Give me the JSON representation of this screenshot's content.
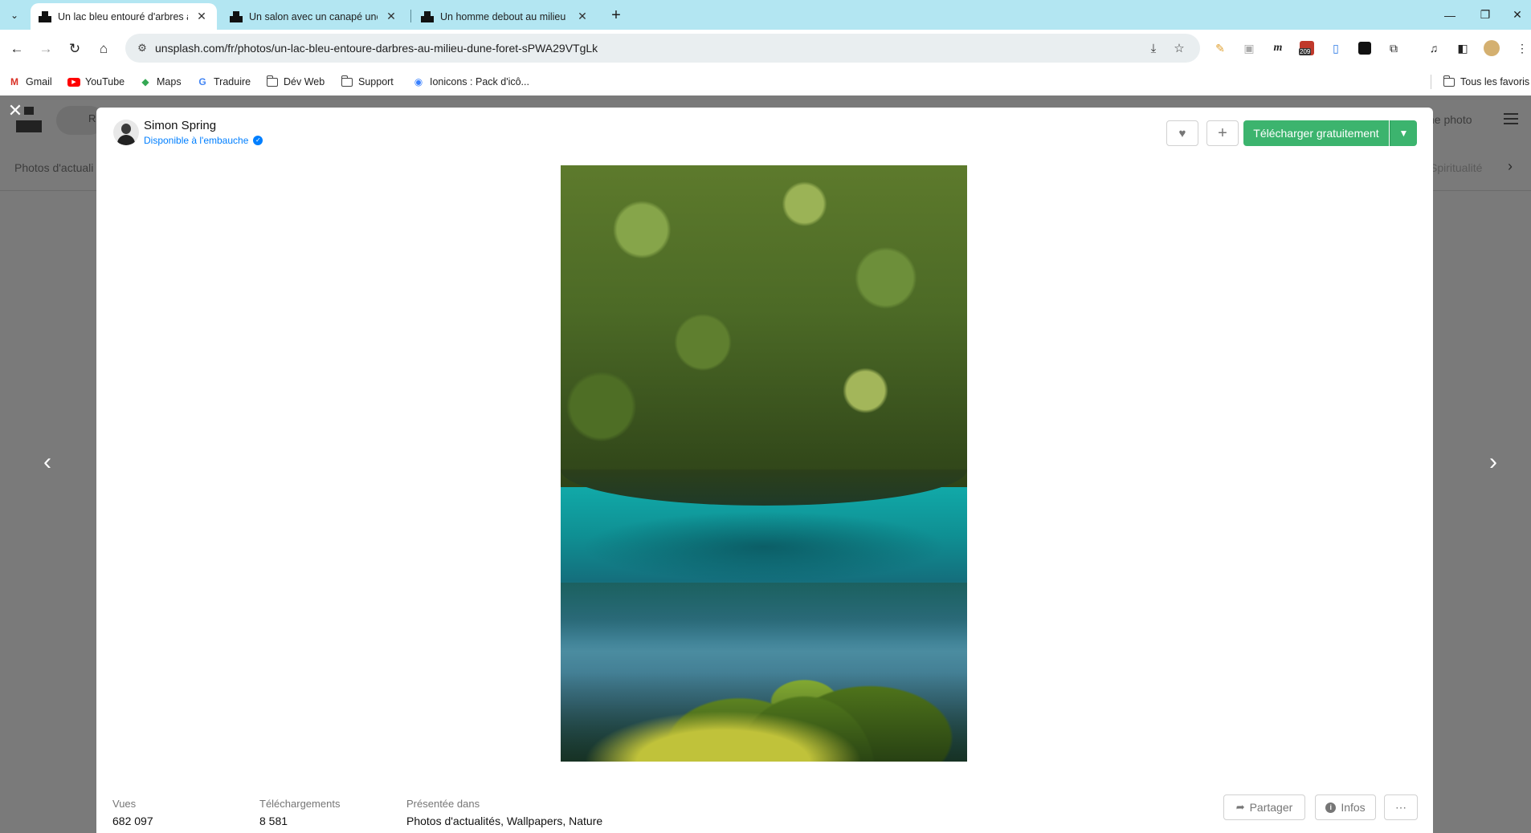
{
  "browser": {
    "tabs": [
      {
        "title": "Un lac bleu entouré d'arbres au",
        "active": true
      },
      {
        "title": "Un salon avec un canapé une ta",
        "active": false
      },
      {
        "title": "Un homme debout au milieu d",
        "active": false
      }
    ],
    "url": "unsplash.com/fr/photos/un-lac-bleu-entoure-darbres-au-milieu-dune-foret-sPWA29VTgLk",
    "extension_badge": "209",
    "bookmarks": [
      {
        "label": "Gmail",
        "icon": "gmail-icon"
      },
      {
        "label": "YouTube",
        "icon": "youtube-icon"
      },
      {
        "label": "Maps",
        "icon": "maps-icon"
      },
      {
        "label": "Traduire",
        "icon": "translate-icon"
      },
      {
        "label": "Dév Web",
        "icon": "folder-icon"
      },
      {
        "label": "Support",
        "icon": "folder-icon"
      },
      {
        "label": "Ionicons : Pack d'icô...",
        "icon": "ionicons-icon"
      }
    ],
    "all_bookmarks": "Tous les favoris"
  },
  "background_page": {
    "topic_left": "Photos d'actuali",
    "topic_right": "Spiritualité",
    "submit_partial": "ne photo"
  },
  "modal": {
    "author": {
      "name": "Simon Spring",
      "hire_text": "Disponible à l'embauche"
    },
    "download_label": "Télécharger gratuitement",
    "stats": {
      "views_label": "Vues",
      "views_value": "682 097",
      "downloads_label": "Téléchargements",
      "downloads_value": "8 581",
      "featured_label": "Présentée dans",
      "featured_value": "Photos d'actualités, Wallpapers, Nature"
    },
    "share_label": "Partager",
    "info_label": "Infos"
  },
  "colors": {
    "accent_green": "#3cb46e",
    "tabstrip": "#b3e6f2",
    "link_blue": "#007fff"
  }
}
